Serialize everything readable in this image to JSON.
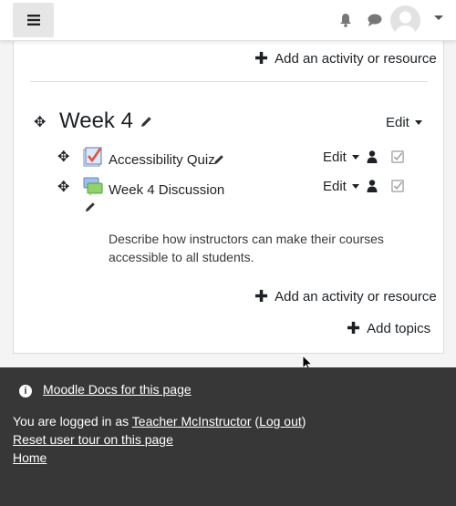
{
  "navbar": {
    "menu_icon": "hamburger-icon",
    "notification_icon": "bell-icon",
    "messages_icon": "chat-icon",
    "user_menu_icon": "avatar"
  },
  "top_add": {
    "label": "Add an activity or resource"
  },
  "section": {
    "title": "Week 4",
    "edit_label": "Edit",
    "activities": [
      {
        "name": "Accessibility Quiz",
        "edit_label": "Edit",
        "icon": "quiz-icon"
      },
      {
        "name": "Week 4 Discussion",
        "edit_label": "Edit",
        "icon": "forum-icon"
      }
    ],
    "description": "Describe how instructors can make their courses accessible to all students.",
    "add_label": "Add an activity or resource"
  },
  "add_topics": {
    "label": "Add topics"
  },
  "footer": {
    "docs_link": "Moodle Docs for this page",
    "logged_in_prefix": "You are logged in as ",
    "user_name": "Teacher McInstructor",
    "logout_open": " (",
    "logout_label": "Log out",
    "logout_close": ")",
    "reset_tour": "Reset user tour on this page",
    "home": "Home"
  }
}
